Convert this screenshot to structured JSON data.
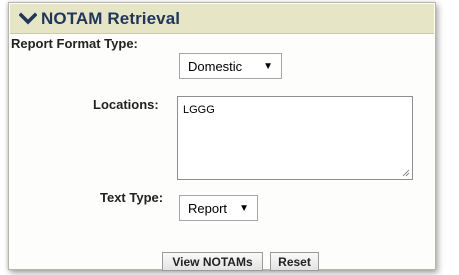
{
  "panel": {
    "title": "NOTAM Retrieval",
    "header_icon": "chevron-down-icon"
  },
  "form": {
    "report_format": {
      "label": "Report Format Type:",
      "selected": "Domestic",
      "arrow_icon": "triangle-down-icon"
    },
    "locations": {
      "label": "Locations:",
      "value": "LGGG"
    },
    "text_type": {
      "label": "Text Type:",
      "selected": "Report",
      "arrow_icon": "triangle-down-icon"
    }
  },
  "buttons": {
    "view_label": "View NOTAMs",
    "reset_label": "Reset"
  },
  "colors": {
    "header_bg": "#e6e6c6",
    "title": "#20375a"
  }
}
